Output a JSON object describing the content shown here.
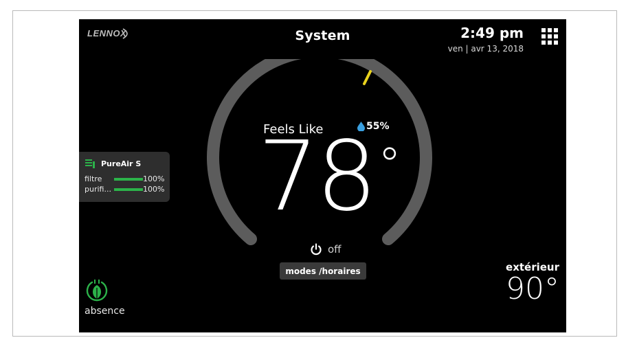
{
  "header": {
    "brand": "LENNOX",
    "title": "System",
    "time": "2:49 pm",
    "date": "ven | avr 13, 2018",
    "menu_icon": "grid-icon"
  },
  "thermostat": {
    "feels_like_label": "Feels Like",
    "humidity": "55%",
    "temperature": "78",
    "degree": "°",
    "setpoint_color": "#e8d21d",
    "arc_color": "#5c5c5c",
    "power_label": "off",
    "modes_button": "modes /horaires"
  },
  "pureair": {
    "name": "PureAir S",
    "rows": [
      {
        "label": "filtre",
        "percent": "100%",
        "level": 1.0
      },
      {
        "label": "purifi...",
        "percent": "100%",
        "level": 1.0
      }
    ],
    "bar_color": "#2cb34a"
  },
  "away": {
    "label": "absence",
    "icon": "eco-leaf-icon",
    "accent": "#2cb34a"
  },
  "outdoor": {
    "label": "extérieur",
    "temperature": "90°"
  }
}
